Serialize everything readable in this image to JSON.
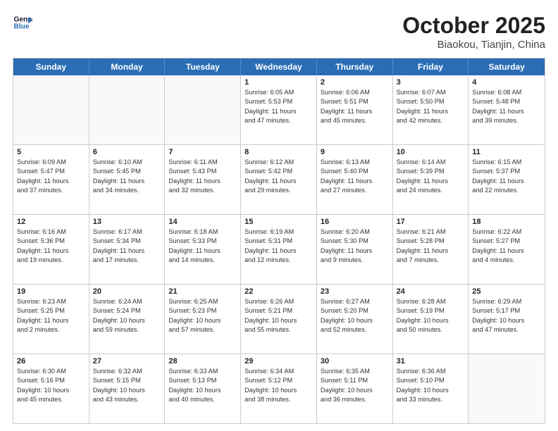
{
  "logo": {
    "line1": "General",
    "line2": "Blue",
    "arrow_color": "#2a6db5"
  },
  "title": "October 2025",
  "location": "Biaokou, Tianjin, China",
  "weekdays": [
    "Sunday",
    "Monday",
    "Tuesday",
    "Wednesday",
    "Thursday",
    "Friday",
    "Saturday"
  ],
  "rows": [
    [
      {
        "day": "",
        "info": "",
        "empty": true
      },
      {
        "day": "",
        "info": "",
        "empty": true
      },
      {
        "day": "",
        "info": "",
        "empty": true
      },
      {
        "day": "1",
        "info": "Sunrise: 6:05 AM\nSunset: 5:53 PM\nDaylight: 11 hours\nand 47 minutes."
      },
      {
        "day": "2",
        "info": "Sunrise: 6:06 AM\nSunset: 5:51 PM\nDaylight: 11 hours\nand 45 minutes."
      },
      {
        "day": "3",
        "info": "Sunrise: 6:07 AM\nSunset: 5:50 PM\nDaylight: 11 hours\nand 42 minutes."
      },
      {
        "day": "4",
        "info": "Sunrise: 6:08 AM\nSunset: 5:48 PM\nDaylight: 11 hours\nand 39 minutes."
      }
    ],
    [
      {
        "day": "5",
        "info": "Sunrise: 6:09 AM\nSunset: 5:47 PM\nDaylight: 11 hours\nand 37 minutes."
      },
      {
        "day": "6",
        "info": "Sunrise: 6:10 AM\nSunset: 5:45 PM\nDaylight: 11 hours\nand 34 minutes."
      },
      {
        "day": "7",
        "info": "Sunrise: 6:11 AM\nSunset: 5:43 PM\nDaylight: 11 hours\nand 32 minutes."
      },
      {
        "day": "8",
        "info": "Sunrise: 6:12 AM\nSunset: 5:42 PM\nDaylight: 11 hours\nand 29 minutes."
      },
      {
        "day": "9",
        "info": "Sunrise: 6:13 AM\nSunset: 5:40 PM\nDaylight: 11 hours\nand 27 minutes."
      },
      {
        "day": "10",
        "info": "Sunrise: 6:14 AM\nSunset: 5:39 PM\nDaylight: 11 hours\nand 24 minutes."
      },
      {
        "day": "11",
        "info": "Sunrise: 6:15 AM\nSunset: 5:37 PM\nDaylight: 11 hours\nand 22 minutes."
      }
    ],
    [
      {
        "day": "12",
        "info": "Sunrise: 6:16 AM\nSunset: 5:36 PM\nDaylight: 11 hours\nand 19 minutes."
      },
      {
        "day": "13",
        "info": "Sunrise: 6:17 AM\nSunset: 5:34 PM\nDaylight: 11 hours\nand 17 minutes."
      },
      {
        "day": "14",
        "info": "Sunrise: 6:18 AM\nSunset: 5:33 PM\nDaylight: 11 hours\nand 14 minutes."
      },
      {
        "day": "15",
        "info": "Sunrise: 6:19 AM\nSunset: 5:31 PM\nDaylight: 11 hours\nand 12 minutes."
      },
      {
        "day": "16",
        "info": "Sunrise: 6:20 AM\nSunset: 5:30 PM\nDaylight: 11 hours\nand 9 minutes."
      },
      {
        "day": "17",
        "info": "Sunrise: 6:21 AM\nSunset: 5:28 PM\nDaylight: 11 hours\nand 7 minutes."
      },
      {
        "day": "18",
        "info": "Sunrise: 6:22 AM\nSunset: 5:27 PM\nDaylight: 11 hours\nand 4 minutes."
      }
    ],
    [
      {
        "day": "19",
        "info": "Sunrise: 6:23 AM\nSunset: 5:25 PM\nDaylight: 11 hours\nand 2 minutes."
      },
      {
        "day": "20",
        "info": "Sunrise: 6:24 AM\nSunset: 5:24 PM\nDaylight: 10 hours\nand 59 minutes."
      },
      {
        "day": "21",
        "info": "Sunrise: 6:25 AM\nSunset: 5:23 PM\nDaylight: 10 hours\nand 57 minutes."
      },
      {
        "day": "22",
        "info": "Sunrise: 6:26 AM\nSunset: 5:21 PM\nDaylight: 10 hours\nand 55 minutes."
      },
      {
        "day": "23",
        "info": "Sunrise: 6:27 AM\nSunset: 5:20 PM\nDaylight: 10 hours\nand 52 minutes."
      },
      {
        "day": "24",
        "info": "Sunrise: 6:28 AM\nSunset: 5:19 PM\nDaylight: 10 hours\nand 50 minutes."
      },
      {
        "day": "25",
        "info": "Sunrise: 6:29 AM\nSunset: 5:17 PM\nDaylight: 10 hours\nand 47 minutes."
      }
    ],
    [
      {
        "day": "26",
        "info": "Sunrise: 6:30 AM\nSunset: 5:16 PM\nDaylight: 10 hours\nand 45 minutes."
      },
      {
        "day": "27",
        "info": "Sunrise: 6:32 AM\nSunset: 5:15 PM\nDaylight: 10 hours\nand 43 minutes."
      },
      {
        "day": "28",
        "info": "Sunrise: 6:33 AM\nSunset: 5:13 PM\nDaylight: 10 hours\nand 40 minutes."
      },
      {
        "day": "29",
        "info": "Sunrise: 6:34 AM\nSunset: 5:12 PM\nDaylight: 10 hours\nand 38 minutes."
      },
      {
        "day": "30",
        "info": "Sunrise: 6:35 AM\nSunset: 5:11 PM\nDaylight: 10 hours\nand 36 minutes."
      },
      {
        "day": "31",
        "info": "Sunrise: 6:36 AM\nSunset: 5:10 PM\nDaylight: 10 hours\nand 33 minutes."
      },
      {
        "day": "",
        "info": "",
        "empty": true
      }
    ]
  ]
}
